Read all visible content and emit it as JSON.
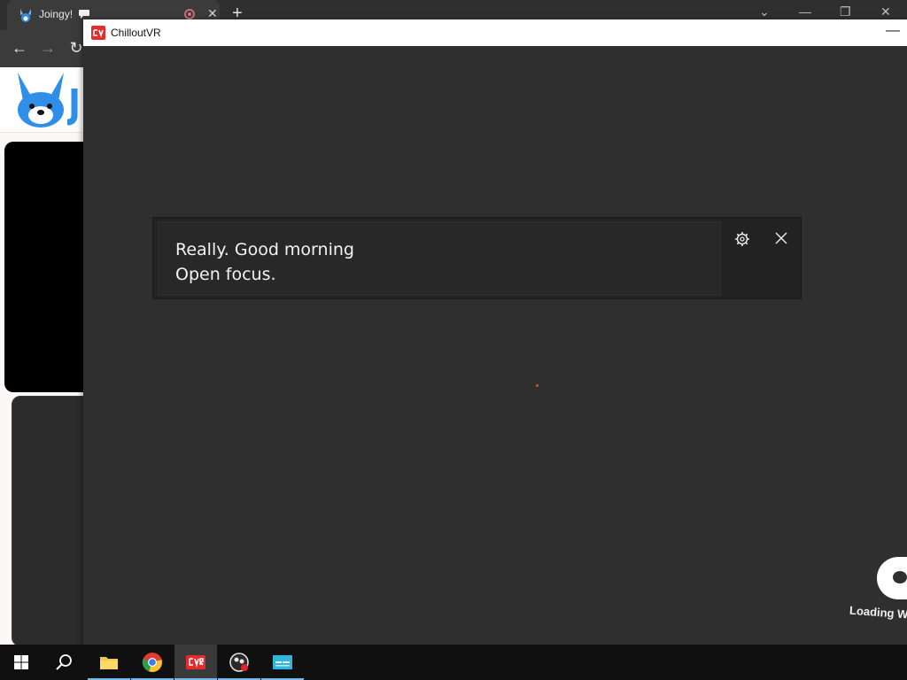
{
  "browser": {
    "tab_title": "Joingy!",
    "tab_close_glyph": "✕",
    "new_tab_glyph": "+",
    "window_controls": [
      "⌄",
      "—",
      "❐",
      "✕"
    ]
  },
  "cvr_window": {
    "title": "ChilloutVR",
    "minimize_glyph": "—"
  },
  "notification": {
    "line1": "Really. Good morning",
    "line2": "Open focus."
  },
  "loading": {
    "text": "Loading W"
  },
  "taskbar": {
    "items": [
      "start",
      "search",
      "file-explorer",
      "chrome",
      "chilloutvr",
      "obs",
      "app"
    ]
  },
  "colors": {
    "accent_red": "#e32d2d",
    "taskbar_underline": "#76b9ed",
    "notification_bg": "#222222"
  }
}
